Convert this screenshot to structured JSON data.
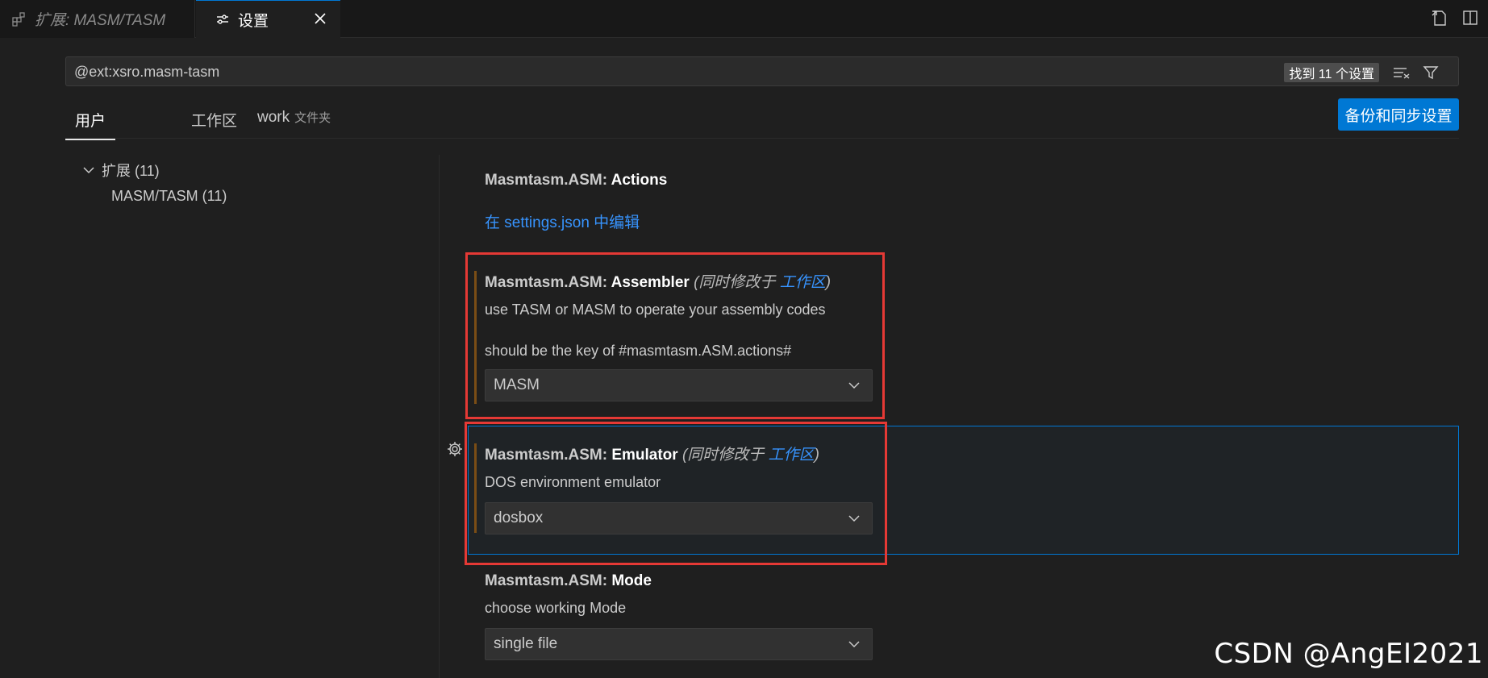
{
  "tabs": {
    "extension_tab": "扩展: MASM/TASM",
    "settings_tab": "设置"
  },
  "search": {
    "value": "@ext:xsro.masm-tasm",
    "result_count": "找到 11 个设置"
  },
  "scopes": {
    "user": "用户",
    "workspace": "工作区",
    "folder": "work",
    "folder_sub": "文件夹"
  },
  "sync_button": "备份和同步设置",
  "toc": {
    "group": "扩展 (11)",
    "child": "MASM/TASM (11)"
  },
  "settings": {
    "actions": {
      "category": "Masmtasm.ASM: ",
      "name": "Actions",
      "edit_link": "在 settings.json 中编辑"
    },
    "assembler": {
      "category": "Masmtasm.ASM: ",
      "name": "Assembler",
      "modified_prefix": "(同时修改于 ",
      "modified_link": "工作区",
      "modified_suffix": ")",
      "desc1": "use TASM or MASM to operate your assembly codes",
      "desc2": "should be the key of #masmtasm.ASM.actions#",
      "value": "MASM"
    },
    "emulator": {
      "category": "Masmtasm.ASM: ",
      "name": "Emulator",
      "modified_prefix": "(同时修改于 ",
      "modified_link": "工作区",
      "modified_suffix": ")",
      "desc": "DOS environment emulator",
      "value": "dosbox"
    },
    "mode": {
      "category": "Masmtasm.ASM: ",
      "name": "Mode",
      "desc": "choose working Mode",
      "value": "single file"
    }
  },
  "watermark": "CSDN @AngEI2021",
  "colors": {
    "accent": "#0078d4",
    "link": "#3794ff",
    "highlight_box": "#e53935",
    "modified_bar": "#7a4d15"
  }
}
